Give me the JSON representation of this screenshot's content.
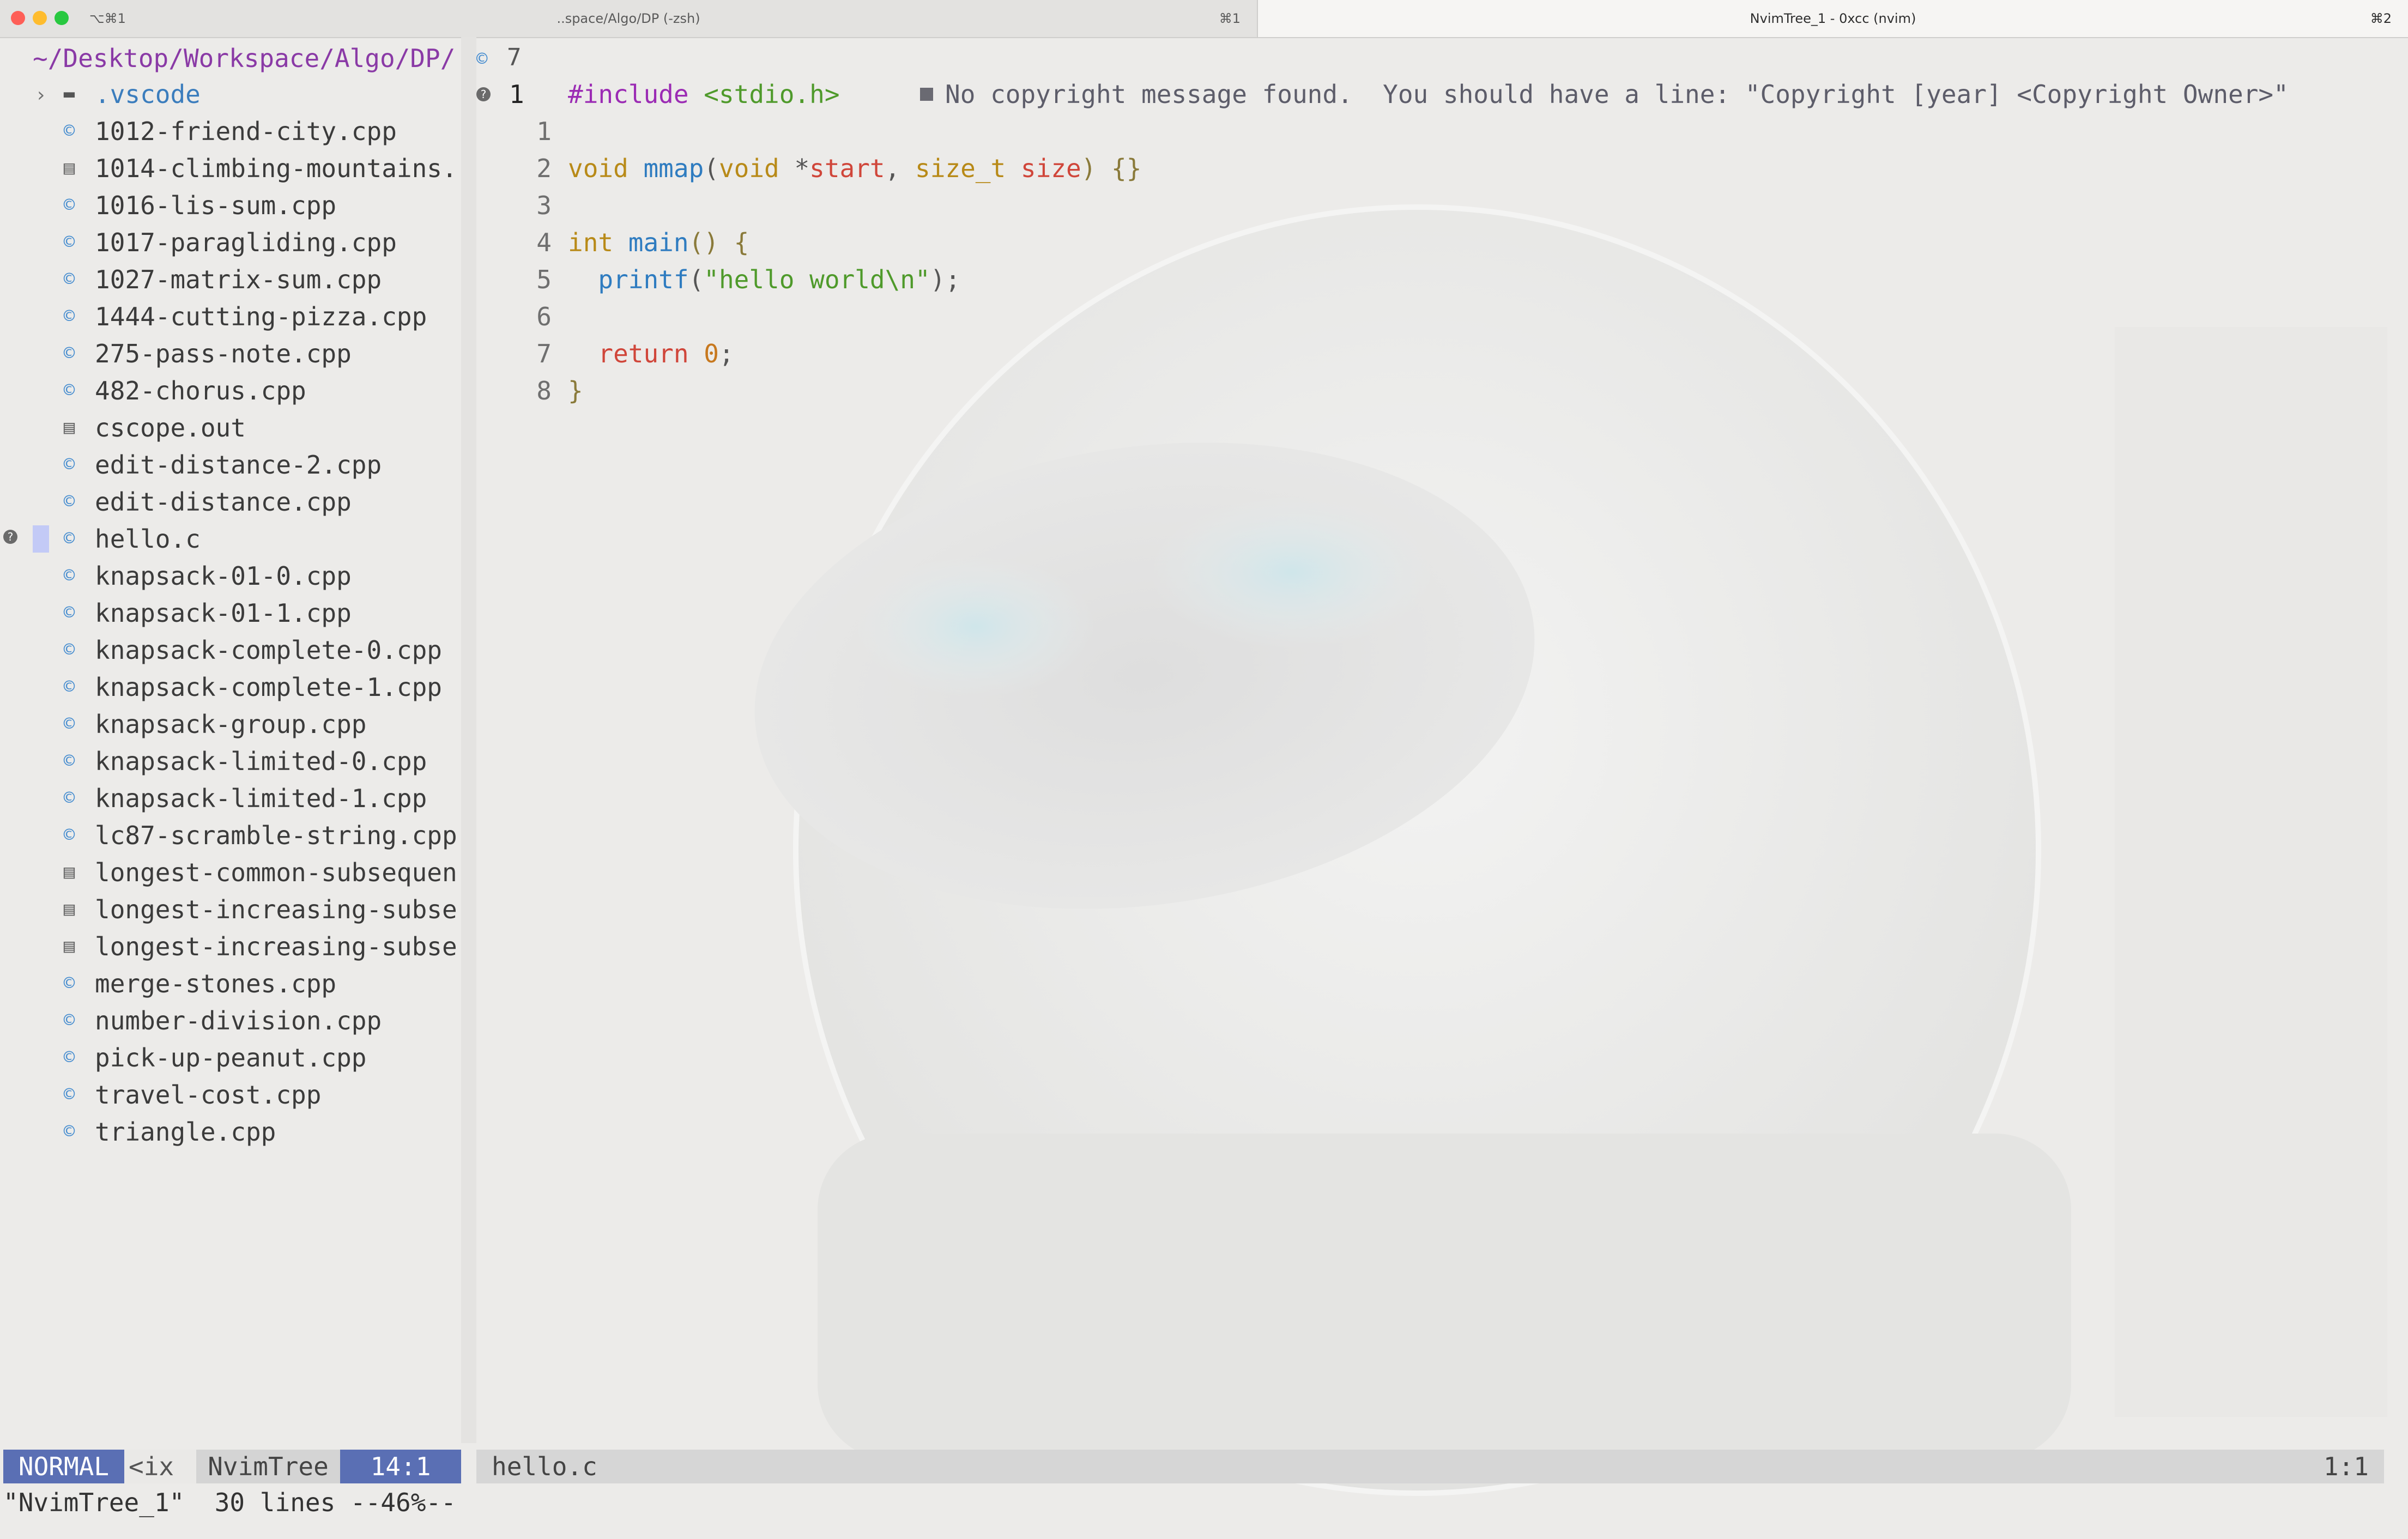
{
  "window": {
    "tab1_title": "..space/Algo/DP (-zsh)",
    "tab1_left_shortcut": "⌥⌘1",
    "tab1_right_shortcut": "⌘1",
    "tab2_title": "NvimTree_1 - 0xcc (nvim)",
    "tab2_right_shortcut": "⌘2"
  },
  "tree": {
    "root": "~/Desktop/Workspace/Algo/DP/",
    "folder": ".vscode",
    "files": [
      "1012-friend-city.cpp",
      "1014-climbing-mountains.",
      "1016-lis-sum.cpp",
      "1017-paragliding.cpp",
      "1027-matrix-sum.cpp",
      "1444-cutting-pizza.cpp",
      "275-pass-note.cpp",
      "482-chorus.cpp",
      "cscope.out",
      "edit-distance-2.cpp",
      "edit-distance.cpp",
      "hello.c",
      "knapsack-01-0.cpp",
      "knapsack-01-1.cpp",
      "knapsack-complete-0.cpp",
      "knapsack-complete-1.cpp",
      "knapsack-group.cpp",
      "knapsack-limited-0.cpp",
      "knapsack-limited-1.cpp",
      "lc87-scramble-string.cpp",
      "longest-common-subsequen",
      "longest-increasing-subse",
      "longest-increasing-subse",
      "merge-stones.cpp",
      "number-division.cpp",
      "pick-up-peanut.cpp",
      "travel-cost.cpp",
      "triangle.cpp"
    ],
    "active_file": "hello.c"
  },
  "editor": {
    "header_count": "7",
    "line_numbers": [
      "1",
      "1",
      "2",
      "3",
      "4",
      "5",
      "6",
      "7",
      "8"
    ],
    "code": {
      "l1_pre": "#include",
      "l1_hdr": "<stdio.h>",
      "l2_void": "void",
      "l2_fn": "mmap",
      "l2_open": "(",
      "l2_void2": "void",
      "l2_star": " *",
      "l2_start": "start",
      "l2_comma": ", ",
      "l2_sizet": "size_t",
      "l2_size": "size",
      "l2_close": ") {}",
      "l4_int": "int",
      "l4_main": "main",
      "l4_rest": "() {",
      "l5_printf": "printf",
      "l5_open": "(",
      "l5_str": "\"hello world\\n\"",
      "l5_close": ");",
      "l7_return": "return",
      "l7_zero": "0",
      "l7_semi": ";",
      "l8_brace": "}"
    },
    "diagnostic": "No copyright message found.  You should have a line: \"Copyright [year] <Copyright Owner>\""
  },
  "statusline": {
    "mode": "NORMAL",
    "encoding": "<ix",
    "filetype": "NvimTree",
    "position": "14:1",
    "editor_file": "hello.c",
    "editor_position": "1:1"
  },
  "cmdline": "\"NvimTree_1\"  30 lines --46%--",
  "colors": {
    "mode_bg": "#5a6fb4",
    "tree_root": "#8a3aa6",
    "file_icon": "#4a8fd0",
    "cursor_bar": "#c3caf6"
  },
  "icons": {
    "file": "c-file-icon",
    "folder": "folder-icon",
    "chevron": "chevron-right-icon",
    "sign": "question-sign-icon"
  }
}
